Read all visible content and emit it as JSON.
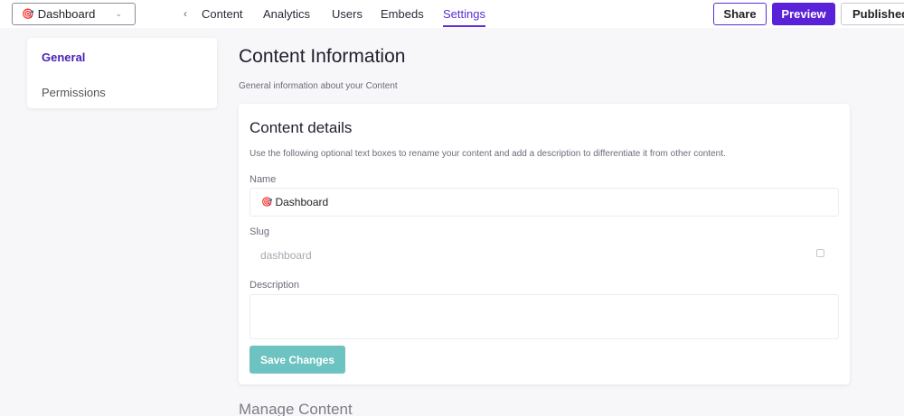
{
  "topbar": {
    "selector": {
      "emoji": "🎯",
      "label": "Dashboard"
    },
    "nav": [
      {
        "label": "Content",
        "active": false
      },
      {
        "label": "Analytics",
        "active": false
      },
      {
        "label": "Users",
        "active": false
      },
      {
        "label": "Embeds",
        "active": false
      },
      {
        "label": "Settings",
        "active": true
      }
    ],
    "share_label": "Share",
    "preview_label": "Preview",
    "published_label": "Published"
  },
  "sidebar": {
    "items": [
      {
        "label": "General",
        "active": true
      },
      {
        "label": "Permissions",
        "active": false
      }
    ]
  },
  "main": {
    "title": "Content Information",
    "subtitle": "General information about your Content",
    "details": {
      "title": "Content details",
      "description": "Use the following optional text boxes to rename your content and add a description to differentiate it from other content.",
      "name_label": "Name",
      "name_emoji": "🎯",
      "name_value": "Dashboard",
      "slug_label": "Slug",
      "slug_value": "dashboard",
      "description_label": "Description",
      "description_value": "",
      "save_label": "Save Changes"
    },
    "manage_title": "Manage Content"
  },
  "colors": {
    "accent": "#5a22d8",
    "save_button": "#6dc3c1"
  }
}
